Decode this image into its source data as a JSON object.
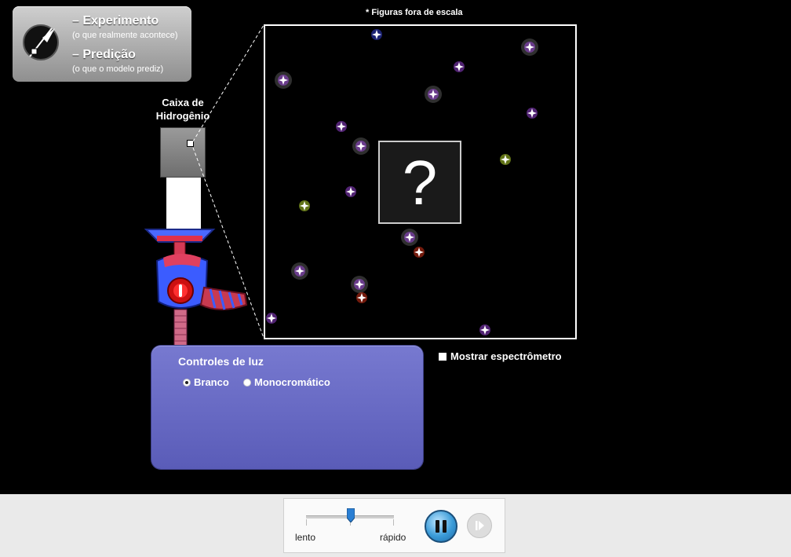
{
  "mode_switch": {
    "experiment_label": "– Experimento",
    "experiment_sub": "(o que realmente acontece)",
    "prediction_label": "– Predição",
    "prediction_sub": "(o que o modelo prediz)"
  },
  "scale_note": "* Figuras fora de escala",
  "hydrogen_box": {
    "line1": "Caixa de",
    "line2": "Hidrogênio"
  },
  "simulation": {
    "unknown_symbol": "?"
  },
  "light_controls": {
    "title": "Controles de luz",
    "options": [
      {
        "label": "Branco",
        "selected": true
      },
      {
        "label": "Monocromático",
        "selected": false
      }
    ]
  },
  "spectrometer": {
    "label": "Mostrar espectrômetro",
    "checked": false
  },
  "clock_controls": {
    "slow_label": "lento",
    "fast_label": "rápido",
    "speed_fraction": 0.5,
    "pause_icon": "pause-icon",
    "step_icon": "step-icon"
  },
  "photon_colors": {
    "violet": "#b34dff",
    "blue": "#3b4cff",
    "red": "#ff3a1a",
    "green": "#d8ff33"
  },
  "colors": {
    "panel": "#6365c4",
    "sim_border": "#ffffff"
  }
}
